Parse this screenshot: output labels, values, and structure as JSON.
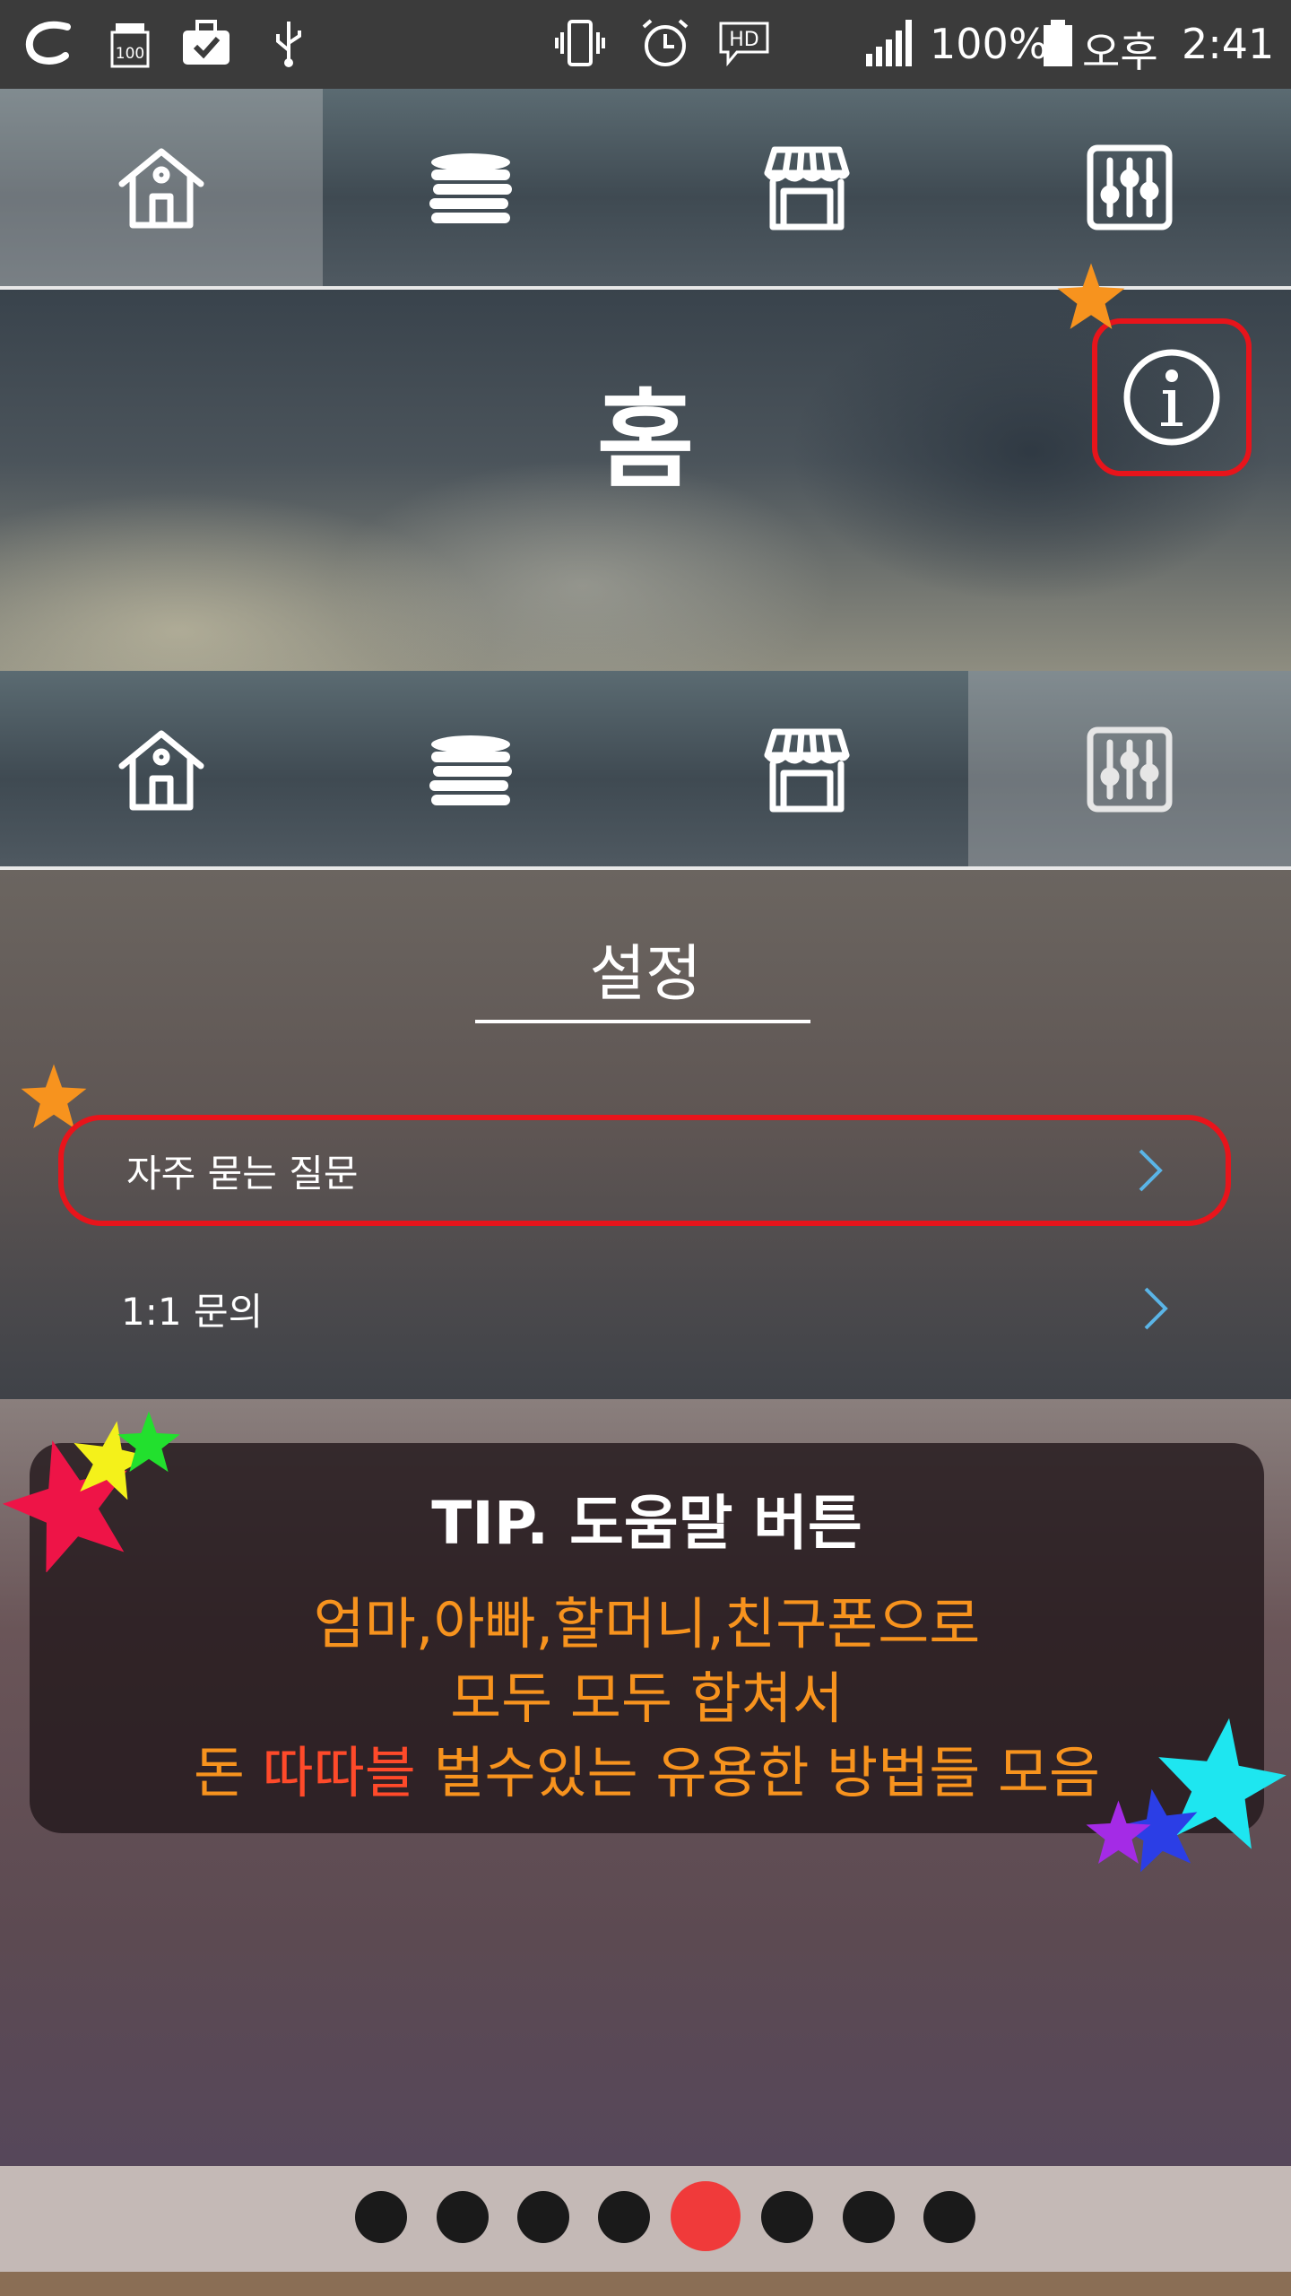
{
  "status_bar": {
    "battery_percent": "100%",
    "ampm": "오후",
    "time": "2:41",
    "icons": [
      "app-icon",
      "battery-saver-icon",
      "briefcase-check-icon",
      "usb-icon",
      "vibrate-icon",
      "alarm-icon",
      "hd-voice-icon",
      "signal-icon",
      "battery-icon"
    ]
  },
  "nav_top": {
    "items": [
      {
        "icon": "home-icon",
        "active": true
      },
      {
        "icon": "coins-icon",
        "active": false
      },
      {
        "icon": "store-icon",
        "active": false
      },
      {
        "icon": "sliders-icon",
        "active": false
      }
    ]
  },
  "home": {
    "title": "홈",
    "info_icon": "info-icon"
  },
  "nav_bottom": {
    "items": [
      {
        "icon": "home-icon",
        "active": false
      },
      {
        "icon": "coins-icon",
        "active": false
      },
      {
        "icon": "store-icon",
        "active": false
      },
      {
        "icon": "sliders-icon",
        "active": true
      }
    ]
  },
  "settings": {
    "title": "설정",
    "rows": [
      {
        "label": "자주 묻는 질문"
      },
      {
        "label": "1:1 문의"
      }
    ]
  },
  "tip": {
    "title": "TIP. 도움말 버튼",
    "line1": "엄마,아빠,할머니,친구폰으로",
    "line2": "모두 모두 합쳐서",
    "line3_a": "돈 ",
    "line3_b": "따따블",
    "line3_c": " 벌수있는 유용한 방법들 모음"
  },
  "pager": {
    "total": 8,
    "active_index": 4
  },
  "colors": {
    "highlight_red": "#e8141b",
    "tip_orange": "#f7931e",
    "tip_red": "#ff4a2a",
    "chevron_blue": "#5ab4e6",
    "pager_active": "#f03a3a"
  }
}
